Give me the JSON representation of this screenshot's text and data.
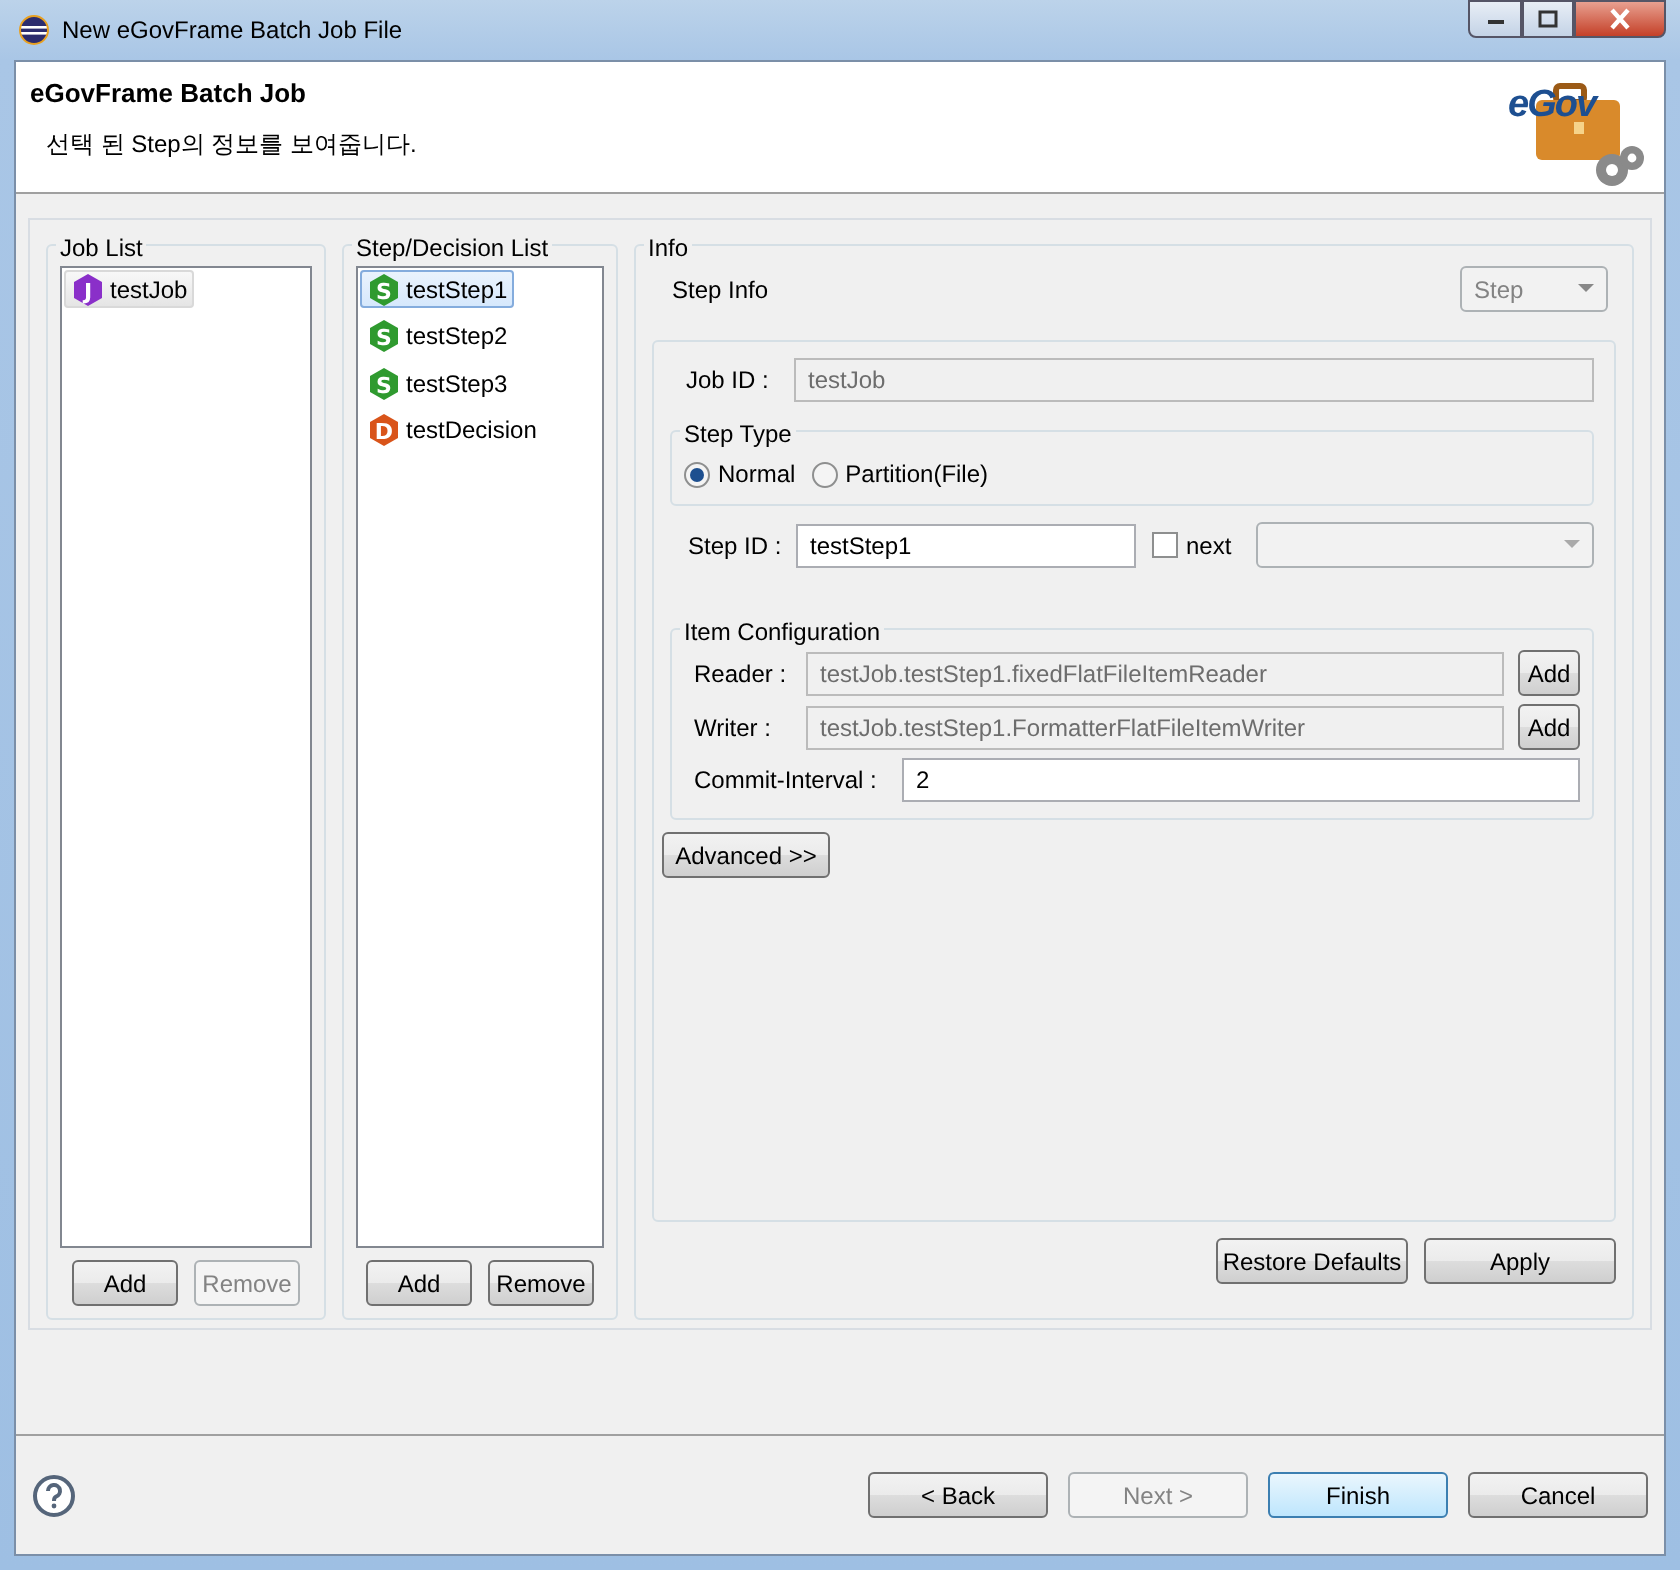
{
  "window": {
    "title": "New eGovFrame Batch Job File"
  },
  "header": {
    "title": "eGovFrame Batch Job",
    "description": "선택 된 Step의 정보를 보여줍니다.",
    "logo_text": "eGov"
  },
  "job_list": {
    "label": "Job List",
    "focused": false,
    "items": [
      {
        "text": "testJob",
        "kind": "job",
        "badge": "J",
        "selected": true
      }
    ],
    "buttons": [
      {
        "label": "Add",
        "disabled": false
      },
      {
        "label": "Remove",
        "disabled": true
      }
    ]
  },
  "step_list": {
    "label": "Step/Decision List",
    "focused": true,
    "items": [
      {
        "text": "testStep1",
        "kind": "step",
        "badge": "S",
        "selected": true
      },
      {
        "text": "testStep2",
        "kind": "step",
        "badge": "S",
        "selected": false
      },
      {
        "text": "testStep3",
        "kind": "step",
        "badge": "S",
        "selected": false
      },
      {
        "text": "testDecision",
        "kind": "decision",
        "badge": "D",
        "selected": false
      }
    ],
    "buttons": [
      {
        "label": "Add",
        "disabled": false
      },
      {
        "label": "Remove",
        "disabled": false
      }
    ]
  },
  "info": {
    "label": "Info",
    "heading": "Step Info",
    "type_select": {
      "value": "Step",
      "disabled": true
    },
    "job_id": {
      "label": "Job ID :",
      "value": "testJob",
      "disabled": true
    },
    "step_type": {
      "label": "Step Type",
      "options": [
        {
          "label": "Normal",
          "selected": true
        },
        {
          "label": "Partition(File)",
          "selected": false
        }
      ]
    },
    "step_id": {
      "label": "Step ID :",
      "value": "testStep1",
      "disabled": false
    },
    "next": {
      "label": "next",
      "checked": false,
      "select_disabled": true
    },
    "item_configuration": {
      "label": "Item Configuration",
      "rows": [
        {
          "label": "Reader :",
          "value": "testJob.testStep1.fixedFlatFileItemReader",
          "disabled": true,
          "button": "Add"
        },
        {
          "label": "Writer :",
          "value": "testJob.testStep1.FormatterFlatFileItemWriter",
          "disabled": true,
          "button": "Add"
        }
      ],
      "commit_interval": {
        "label": "Commit-Interval :",
        "value": "2",
        "disabled": false
      }
    },
    "advanced_button": "Advanced >>",
    "buttons": [
      {
        "label": "Restore Defaults",
        "disabled": false
      },
      {
        "label": "Apply",
        "disabled": false
      }
    ]
  },
  "footer": {
    "buttons": [
      {
        "label": "< Back",
        "disabled": false,
        "default": false
      },
      {
        "label": "Next >",
        "disabled": true,
        "default": false
      },
      {
        "label": "Finish",
        "disabled": false,
        "default": true
      },
      {
        "label": "Cancel",
        "disabled": false,
        "default": false
      }
    ]
  }
}
